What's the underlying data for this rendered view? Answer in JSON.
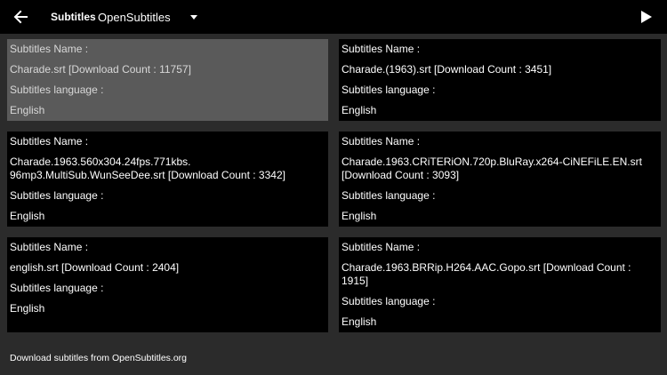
{
  "header": {
    "title": "Subtitles",
    "source_selected": "OpenSubtitles"
  },
  "labels": {
    "name_label": "Subtitles Name :",
    "language_label": "Subtitles language :"
  },
  "subtitles": [
    {
      "name": "Charade.srt [Download Count : 11757]",
      "language": "English"
    },
    {
      "name": "Charade.(1963).srt [Download Count : 3451]",
      "language": "English"
    },
    {
      "name": "Charade.1963.560x304.24fps.771kbs.\n96mp3.MultiSub.WunSeeDee.srt [Download Count : 3342]",
      "language": "English"
    },
    {
      "name": "Charade.1963.CRiTERiON.720p.BluRay.x264-CiNEFiLE.EN.srt\n[Download Count : 3093]",
      "language": "English"
    },
    {
      "name": "english.srt [Download Count : 2404]",
      "language": "English"
    },
    {
      "name": "Charade.1963.BRRip.H264.AAC.Gopo.srt [Download Count :\n1915]",
      "language": "English"
    }
  ],
  "footer": {
    "text": "Download subtitles from OpenSubtitles.org"
  },
  "colors": {
    "background": "#2b2b2b",
    "card": "#000000",
    "card_selected": "#5a5a5a"
  }
}
